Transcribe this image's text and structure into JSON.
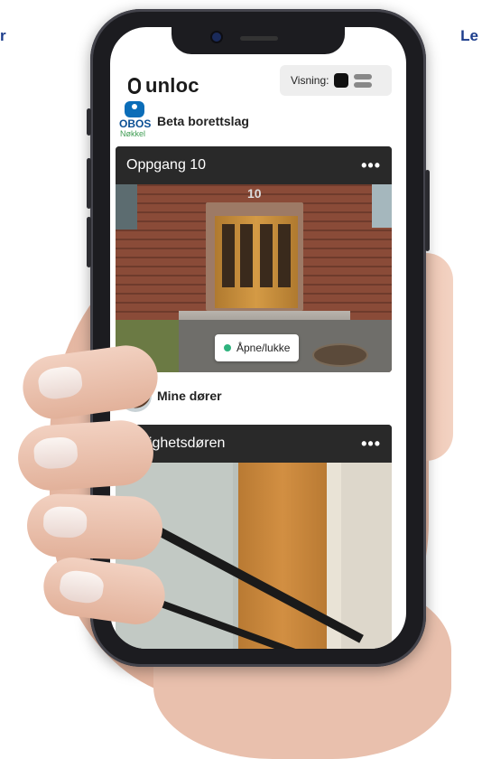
{
  "edge_text": {
    "left": "r",
    "right": "Le"
  },
  "app": {
    "logo_text": "unloc",
    "view_toggle": {
      "label": "Visning:",
      "active": "card"
    }
  },
  "sections": [
    {
      "org_logo_text": "OBOS",
      "org_logo_sub": "Nøkkel",
      "title": "Beta borettslag",
      "doors": [
        {
          "title": "Oppgang 10",
          "action_label": "Åpne/lukke",
          "number": "10"
        }
      ]
    },
    {
      "title": "Mine dører",
      "doors": [
        {
          "title": "Leilighetsdøren"
        }
      ]
    }
  ],
  "icons": {
    "more": "•••"
  },
  "colors": {
    "status_dot": "#2fb37e",
    "obos_blue": "#0b6db8",
    "obos_green": "#3f9c52",
    "header_bar": "#282828"
  }
}
